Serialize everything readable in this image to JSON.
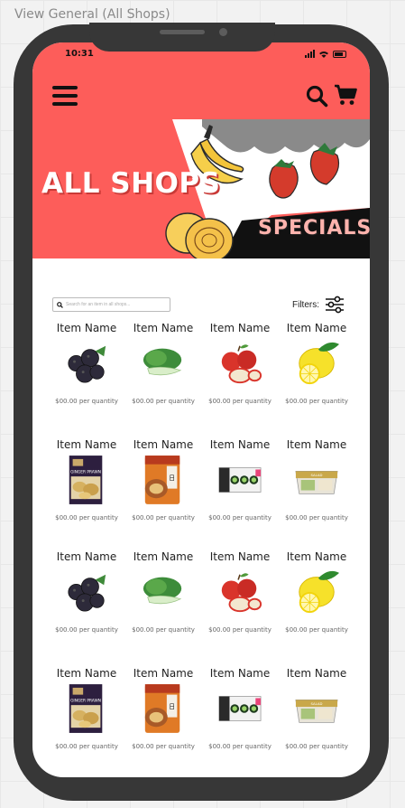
{
  "frame_caption": "View General (All Shops)",
  "status_bar": {
    "time": "10:31"
  },
  "banner": {
    "title": "ALL SHOPS",
    "badge": "SPECIALS"
  },
  "search": {
    "placeholder": "Search for an item in all shops..."
  },
  "filters": {
    "label": "Filters:"
  },
  "items": [
    {
      "name": "Item Name",
      "price": "$00.00 per quantity",
      "icon": "blackberries"
    },
    {
      "name": "Item Name",
      "price": "$00.00 per quantity",
      "icon": "bok-choy"
    },
    {
      "name": "Item Name",
      "price": "$00.00 per quantity",
      "icon": "apples"
    },
    {
      "name": "Item Name",
      "price": "$00.00 per quantity",
      "icon": "lemon"
    },
    {
      "name": "Item Name",
      "price": "$00.00 per quantity",
      "icon": "dumplings-box"
    },
    {
      "name": "Item Name",
      "price": "$00.00 per quantity",
      "icon": "noodle-pack"
    },
    {
      "name": "Item Name",
      "price": "$00.00 per quantity",
      "icon": "sushi-tray"
    },
    {
      "name": "Item Name",
      "price": "$00.00 per quantity",
      "icon": "salad-container"
    },
    {
      "name": "Item Name",
      "price": "$00.00 per quantity",
      "icon": "blackberries"
    },
    {
      "name": "Item Name",
      "price": "$00.00 per quantity",
      "icon": "bok-choy"
    },
    {
      "name": "Item Name",
      "price": "$00.00 per quantity",
      "icon": "apples"
    },
    {
      "name": "Item Name",
      "price": "$00.00 per quantity",
      "icon": "lemon"
    },
    {
      "name": "Item Name",
      "price": "$00.00 per quantity",
      "icon": "dumplings-box"
    },
    {
      "name": "Item Name",
      "price": "$00.00 per quantity",
      "icon": "noodle-pack"
    },
    {
      "name": "Item Name",
      "price": "$00.00 per quantity",
      "icon": "sushi-tray"
    },
    {
      "name": "Item Name",
      "price": "$00.00 per quantity",
      "icon": "salad-container"
    }
  ],
  "colors": {
    "header": "#fd5d5a",
    "phone_frame": "#373737",
    "specials_text": "#ffb3ad"
  }
}
